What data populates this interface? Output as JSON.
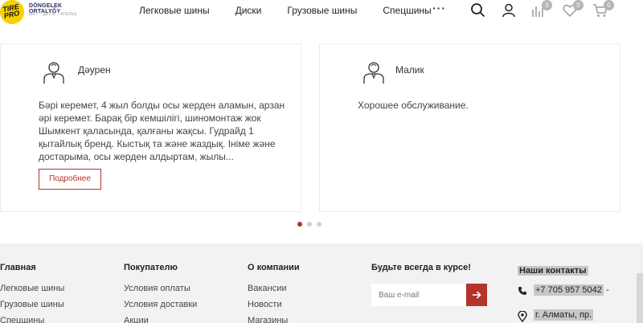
{
  "header": {
    "logo": {
      "brand": "TIRE PRO",
      "title": "DÖNGELEK ORTALYĞY",
      "subtitle": "ШЕТ · ДИСКІ · АТЕЛЬЕ"
    },
    "nav": [
      "Легковые шины",
      "Диски",
      "Грузовые шины",
      "Спецшины"
    ],
    "more": "···",
    "badges": {
      "compare": "0",
      "favorites": "0",
      "cart": "0"
    }
  },
  "reviews": [
    {
      "name": "Дәурен",
      "text": "Бәрі керемет, 4 жыл болды осы жерден аламын, арзан әрі керемет. Барақ бір кемшілігі, шиномонтаж жок Шымкент қаласында, қалғаны жақсы. Гудрайд 1 қытайлық бренд. Кыстық та және жаздық. Ініме және достарыма, осы жерден алдыртам, жылы...",
      "more": "Подробнее"
    },
    {
      "name": "Малик",
      "text": "Хорошее обслуживание."
    }
  ],
  "footer": {
    "col1": {
      "title": "Главная",
      "links": [
        "Легковые шины",
        "Грузовые шины",
        "Спецшины"
      ]
    },
    "col2": {
      "title": "Покупателю",
      "links": [
        "Условия оплаты",
        "Условия доставки",
        "Акции"
      ]
    },
    "col3": {
      "title": "О компании",
      "links": [
        "Вакансии",
        "Новости",
        "Магазины"
      ]
    },
    "col4": {
      "title": "Будьте всегда в курсе!",
      "email_placeholder": "Ваш e-mail"
    },
    "col5": {
      "title": "Наши контакты",
      "phone": "+7 705 957 5042",
      "phone_suffix": " -",
      "address": "г. Алматы, пр."
    }
  },
  "colors": {
    "accent": "#b4332b",
    "logo_yellow": "#f5d100"
  }
}
